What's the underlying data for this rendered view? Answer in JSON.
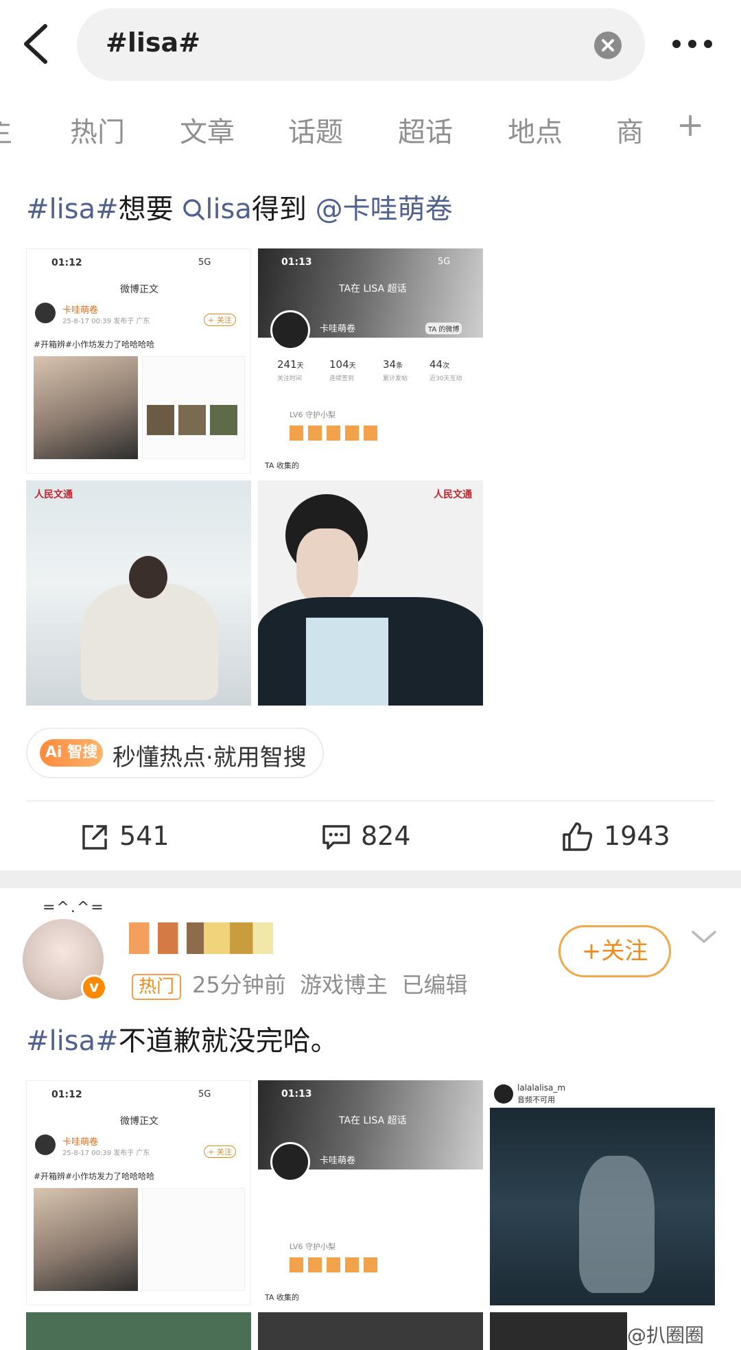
{
  "search": {
    "query": "#lisa#"
  },
  "tabs": [
    "主",
    "热门",
    "文章",
    "话题",
    "超话",
    "地点",
    "商"
  ],
  "post1": {
    "hashtag": "#lisa#",
    "text1": "想要",
    "search_word": "lisa",
    "text2": "得到",
    "mention": "@卡哇萌卷",
    "screenshot_a": {
      "time": "01:12",
      "signal": "5G",
      "title": "微博正文",
      "user": "卡哇萌卷",
      "date": "25-8-17 00:39 发布于 广东",
      "follow": "+ 关注",
      "body": "#开箱辨#小作坊发力了哈哈哈哈"
    },
    "screenshot_b": {
      "time": "01:13",
      "signal": "5G",
      "title": "TA在 LISA 超话",
      "user": "卡哇萌卷",
      "weibo_link": "TA 的微博",
      "stats": [
        {
          "value": "241",
          "unit": "天",
          "label": "关注时间"
        },
        {
          "value": "104",
          "unit": "天",
          "label": "连续签到"
        },
        {
          "value": "34",
          "unit": "条",
          "label": "累计发帖"
        },
        {
          "value": "44",
          "unit": "次",
          "label": "近30天互动"
        }
      ],
      "level": "LV6 守护小梨",
      "collected": "TA 收集的"
    },
    "photo_brand": "人民文通",
    "ai": {
      "badge": "Ai 智搜",
      "text": "秒懂热点·就用智搜"
    },
    "actions": {
      "share": "541",
      "comment": "824",
      "like": "1943"
    }
  },
  "post2": {
    "avatar_deco": "=^.^=",
    "follow": "+关注",
    "hot_tag": "热门",
    "time": "25分钟前",
    "role": "游戏博主",
    "edited": "已编辑",
    "hashtag": "#lisa#",
    "text": "不道歉就没完哈。",
    "insta_user": "lalalalisa_m",
    "insta_sub": "音频不可用"
  },
  "watermark": "@扒圈圈",
  "colors": {
    "link": "#50618f",
    "orange": "#f08b1b"
  }
}
